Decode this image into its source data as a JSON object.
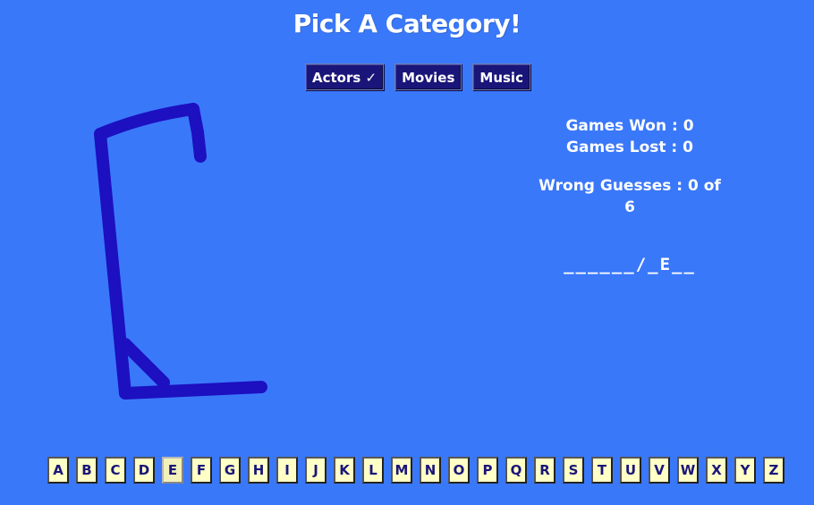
{
  "title": "Pick A Category!",
  "categories": [
    {
      "label": "Actors",
      "check": "✓"
    },
    {
      "label": "Movies"
    },
    {
      "label": "Music"
    }
  ],
  "stats": {
    "won_label": "Games Won : 0",
    "lost_label": "Games Lost : 0",
    "wrong_label": "Wrong Guesses : 0 of 6"
  },
  "word": "______/_E__",
  "letters": [
    "A",
    "B",
    "C",
    "D",
    "E",
    "F",
    "G",
    "H",
    "I",
    "J",
    "K",
    "L",
    "M",
    "N",
    "O",
    "P",
    "Q",
    "R",
    "S",
    "T",
    "U",
    "V",
    "W",
    "X",
    "Y",
    "Z"
  ],
  "used_letters": [
    "E"
  ],
  "colors": {
    "background": "#3a78fa",
    "button": "#1a1578",
    "gallows": "#1c10c0",
    "letter_tile": "#ffffc6"
  }
}
